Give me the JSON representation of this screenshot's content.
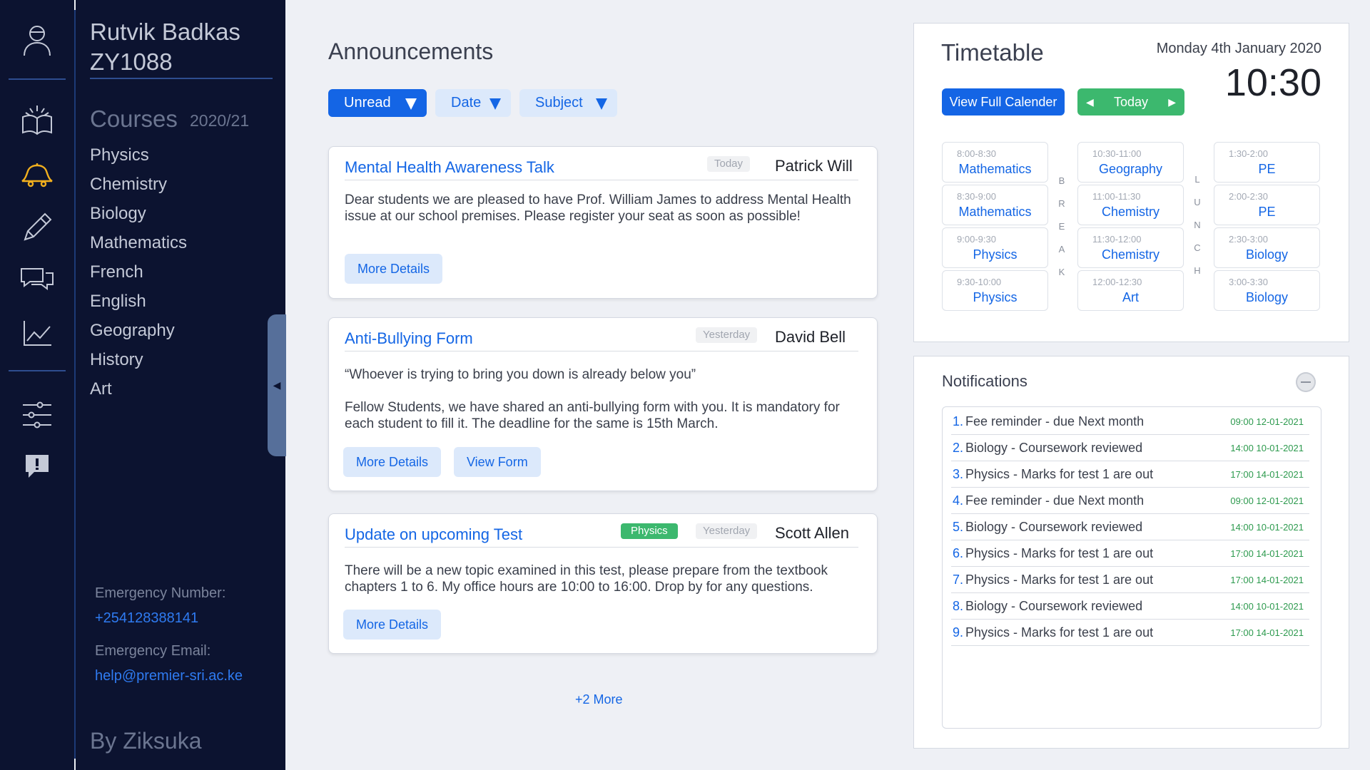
{
  "rail": {
    "icons": [
      "profile-icon",
      "courses-book-icon",
      "announcements-bell-icon",
      "assignments-pencil-icon",
      "messages-chat-icon",
      "progress-chart-icon",
      "settings-sliders-icon",
      "feedback-alert-icon"
    ],
    "active_icon": "announcements-bell-icon",
    "active_color": "#f2b01e"
  },
  "user": {
    "name": "Rutvik Badkas",
    "id": "ZY1088"
  },
  "courses": {
    "heading": "Courses",
    "year": "2020/21",
    "items": [
      "Physics",
      "Chemistry",
      "Biology",
      "Mathematics",
      "French",
      "English",
      "Geography",
      "History",
      "Art"
    ]
  },
  "emergency": {
    "number_label": "Emergency Number:",
    "number": "+254128388141",
    "email_label": "Emergency Email:",
    "email": "help@premier-sri.ac.ke"
  },
  "footer": {
    "credit": "By Ziksuka"
  },
  "announcements": {
    "title": "Announcements",
    "filters": [
      "Unread",
      "Date",
      "Subject"
    ],
    "items": [
      {
        "title": "Mental Health Awareness Talk",
        "when": "Today",
        "author": "Patrick Will",
        "body": "Dear students we are pleased to have Prof. William James to address Mental Health issue at our school premises. Please register your seat as soon as possible!",
        "buttons": [
          "More Details"
        ]
      },
      {
        "title": "Anti-Bullying Form",
        "when": "Yesterday",
        "author": "David Bell",
        "quote": "“Whoever is trying to bring you down is already below you”",
        "body": "Fellow Students, we have shared an anti-bullying form with you. It is mandatory for each student to fill it. The deadline for the same is 15th March.",
        "buttons": [
          "More Details",
          "View Form"
        ]
      },
      {
        "title": "Update on upcoming Test",
        "subject": "Physics",
        "when": "Yesterday",
        "author": "Scott Allen",
        "body": "There will be a new topic examined in this test, please prepare from the textbook chapters 1 to 6. My office hours are 10:00 to 16:00. Drop by for any questions.",
        "buttons": [
          "More Details"
        ]
      }
    ],
    "more_link": "+2 More"
  },
  "timetable": {
    "title": "Timetable",
    "date": "Monday 4th January 2020",
    "time": "10:30",
    "full_button": "View Full Calender",
    "today_button": "Today",
    "columns": [
      [
        {
          "time": "8:00-8:30",
          "subject": "Mathematics"
        },
        {
          "time": "8:30-9:00",
          "subject": "Mathematics"
        },
        {
          "time": "9:00-9:30",
          "subject": "Physics"
        },
        {
          "time": "9:30-10:00",
          "subject": "Physics"
        }
      ],
      [
        {
          "time": "10:30-11:00",
          "subject": "Geography"
        },
        {
          "time": "11:00-11:30",
          "subject": "Chemistry"
        },
        {
          "time": "11:30-12:00",
          "subject": "Chemistry"
        },
        {
          "time": "12:00-12:30",
          "subject": "Art"
        }
      ],
      [
        {
          "time": "1:30-2:00",
          "subject": "PE"
        },
        {
          "time": "2:00-2:30",
          "subject": "PE"
        },
        {
          "time": "2:30-3:00",
          "subject": "Biology"
        },
        {
          "time": "3:00-3:30",
          "subject": "Biology"
        }
      ]
    ],
    "break_letters": [
      "B",
      "R",
      "E",
      "A",
      "K"
    ],
    "lunch_letters": [
      "L",
      "U",
      "N",
      "C",
      "H"
    ]
  },
  "notifications": {
    "title": "Notifications",
    "items": [
      {
        "num": "1.",
        "text": "Fee reminder - due Next month",
        "time": "09:00 12-01-2021"
      },
      {
        "num": "2.",
        "text": "Biology - Coursework reviewed",
        "time": "14:00 10-01-2021"
      },
      {
        "num": "3.",
        "text": "Physics - Marks for test 1 are out",
        "time": "17:00 14-01-2021"
      },
      {
        "num": "4.",
        "text": "Fee reminder - due Next month",
        "time": "09:00 12-01-2021"
      },
      {
        "num": "5.",
        "text": "Biology - Coursework reviewed",
        "time": "14:00 10-01-2021"
      },
      {
        "num": "6.",
        "text": "Physics - Marks for test 1 are out",
        "time": "17:00 14-01-2021"
      },
      {
        "num": "7.",
        "text": "Physics - Marks for test 1 are out",
        "time": "17:00 14-01-2021"
      },
      {
        "num": "8.",
        "text": "Biology - Coursework reviewed",
        "time": "14:00 10-01-2021"
      },
      {
        "num": "9.",
        "text": "Physics - Marks for test 1 are out",
        "time": "17:00 14-01-2021"
      }
    ]
  },
  "colors": {
    "sidebar_bg": "#0c1330",
    "accent_blue": "#1465e5",
    "soft_blue": "#dce9fb",
    "green": "#3cb86e",
    "page_bg": "#eef0f5"
  }
}
